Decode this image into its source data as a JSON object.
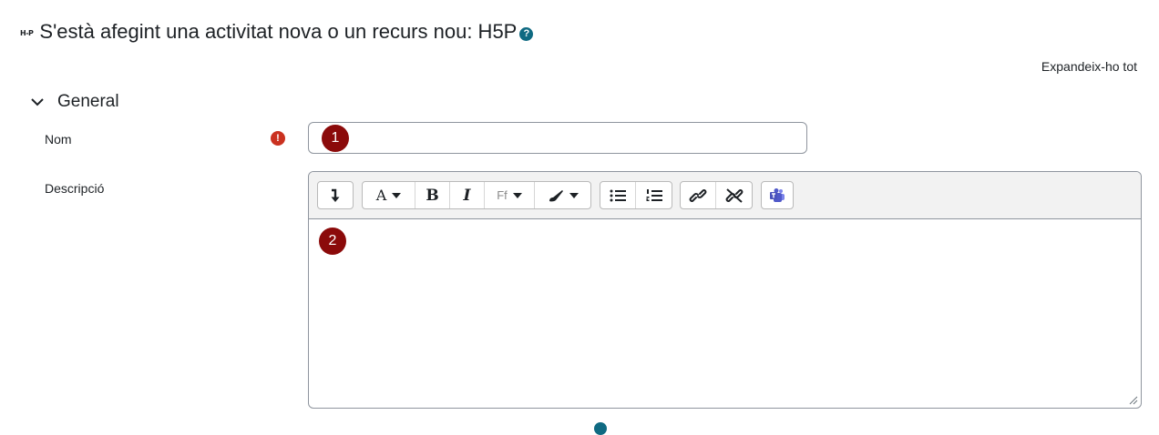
{
  "header": {
    "logo_text": "H-P",
    "title": "S'està afegint una activitat nova o un recurs nou: H5P",
    "help_icon": "?",
    "help_icon_name": "help-icon"
  },
  "expand_all_label": "Expandeix-ho tot",
  "section": {
    "title": "General",
    "icon": "chevron-down-icon"
  },
  "fields": {
    "name": {
      "label": "Nom",
      "value": "",
      "required_icon": "!"
    },
    "description": {
      "label": "Descripció",
      "value": ""
    }
  },
  "badges": {
    "one": "1",
    "two": "2"
  },
  "toolbar": {
    "font_style_label": "A",
    "bold_label": "B",
    "italic_label": "I",
    "font_family_label": "Ff",
    "buttons": [
      "collapse-toolbar-icon",
      "font-style-icon",
      "bold-icon",
      "italic-icon",
      "font-family-icon",
      "text-color-icon",
      "unordered-list-icon",
      "ordered-list-icon",
      "link-icon",
      "unlink-icon",
      "teams-meeting-icon"
    ]
  },
  "colors": {
    "accent": "#0f6a82",
    "required": "#ca3120",
    "badge": "#8b0a0a",
    "teams": "#5059c9"
  }
}
